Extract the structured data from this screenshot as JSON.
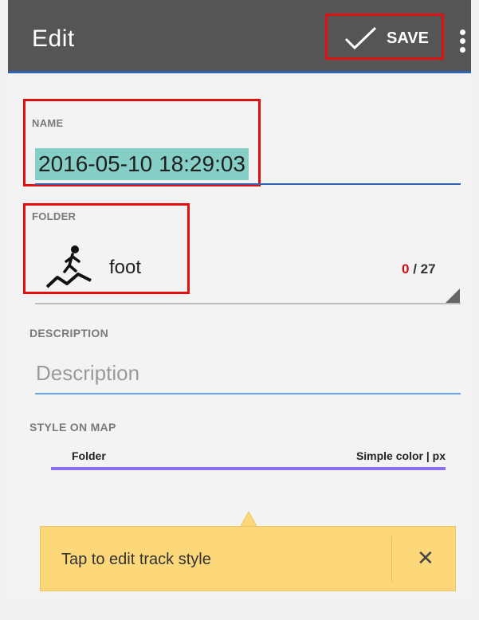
{
  "appbar": {
    "title": "Edit",
    "save_label": "SAVE",
    "background_color": "#555555",
    "accent_color": "#2f62b3"
  },
  "form": {
    "name": {
      "label": "NAME",
      "value": "2016-05-10 18:29:03"
    },
    "folder": {
      "label": "FOLDER",
      "icon": "hiking-foot-icon",
      "value": "foot",
      "counter_current": "0",
      "counter_separator": "/",
      "counter_total": "27"
    },
    "description": {
      "label": "DESCRIPTION",
      "value": "",
      "placeholder": "Description"
    },
    "style_on_map": {
      "label": "STYLE ON MAP",
      "source": "Folder",
      "style": "Simple color | px",
      "line_color": "#8a70ee"
    }
  },
  "tooltip": {
    "text": "Tap to edit track style",
    "close_icon": "close-icon",
    "background_color": "#fcd87a"
  },
  "highlight_color": "#e01010"
}
